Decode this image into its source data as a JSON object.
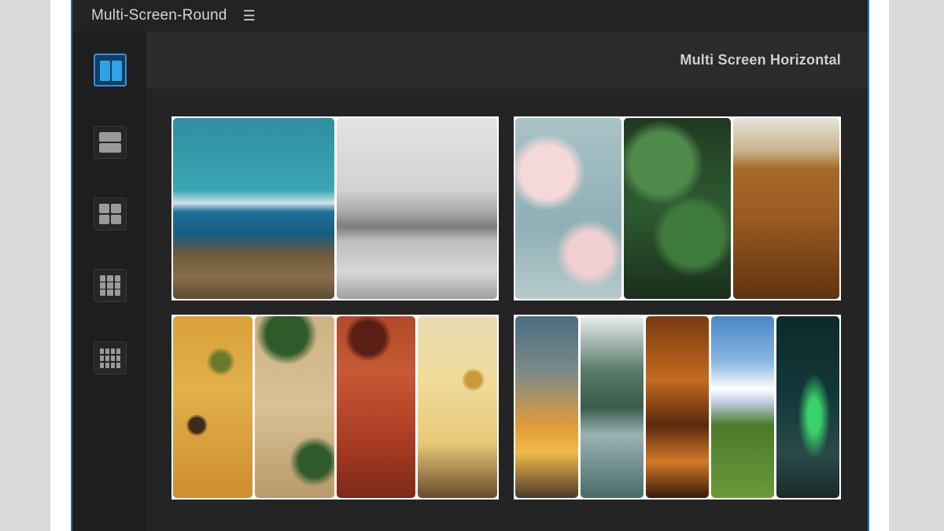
{
  "window": {
    "title": "Multi-Screen-Round",
    "menu_glyph": "☰"
  },
  "sidebar": {
    "items": [
      {
        "id": "layout-2-columns",
        "icon": "two-columns-icon",
        "active": true
      },
      {
        "id": "layout-2-rows",
        "icon": "two-rows-icon",
        "active": false
      },
      {
        "id": "layout-2x2",
        "icon": "grid-2x2-icon",
        "active": false
      },
      {
        "id": "layout-3x3",
        "icon": "grid-3x3-icon",
        "active": false
      },
      {
        "id": "layout-4x3",
        "icon": "grid-4x3-icon",
        "active": false
      }
    ]
  },
  "main": {
    "header_title": "Multi Screen Horizontal",
    "presets": [
      {
        "id": "preset-2",
        "screens": 2,
        "subjects": [
          "coastal cliffs and sea",
          "black and white waterfront town"
        ]
      },
      {
        "id": "preset-3",
        "screens": 3,
        "subjects": [
          "cherry blossoms",
          "green leaves",
          "wheat field"
        ]
      },
      {
        "id": "preset-4",
        "screens": 4,
        "subjects": [
          "pizza",
          "spaghetti",
          "pepperoni pizza",
          "cheese"
        ]
      },
      {
        "id": "preset-5",
        "screens": 5,
        "subjects": [
          "sunset sky",
          "misty mountain lake",
          "autumn forest",
          "alpine meadow",
          "aurora borealis"
        ]
      }
    ]
  },
  "colors": {
    "accent": "#3c8fcf",
    "panel_bg": "#1b1b1b",
    "main_bg": "#242424",
    "header_bg": "#2b2b2b"
  }
}
